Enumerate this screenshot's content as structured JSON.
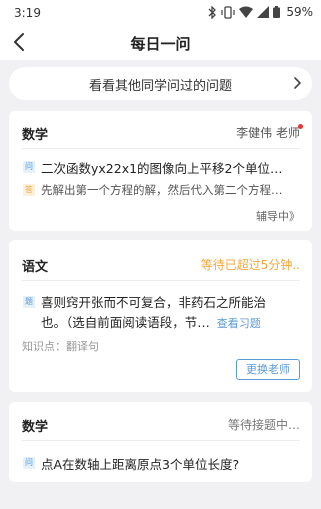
{
  "status_bar": {
    "time": "3:19",
    "battery": "59%"
  },
  "nav": {
    "title": "每日一问"
  },
  "other_questions": {
    "label": "看看其他同学问过的问题"
  },
  "cards": [
    {
      "subject": "数学",
      "teacher": "李健伟 老师",
      "question_tag": "问",
      "question": "二次函数yx22x1的图像向上平移2个单位…",
      "answer_tag": "答",
      "answer": "先解出第一个方程的解，然后代入第二个方程…",
      "status": "辅导中》"
    },
    {
      "subject": "语文",
      "status": "等待已超过5分钟..",
      "question_tag": "题",
      "question_line1": "喜则窍开张而不可复合，非药石之所能治",
      "question_line2": "也。（选自前面阅读语段，节…",
      "view_link": "查看习题",
      "knowledge": "知识点：翻译句",
      "change_teacher": "更换老师"
    },
    {
      "subject": "数学",
      "status": "等待接题中…",
      "question_tag": "问",
      "question": "点A在数轴上距离原点3个单位长度?"
    }
  ],
  "colors": {
    "accent_blue": "#5b9bd5",
    "waiting_orange": "#f4a63a",
    "dot_red": "#e53935"
  }
}
